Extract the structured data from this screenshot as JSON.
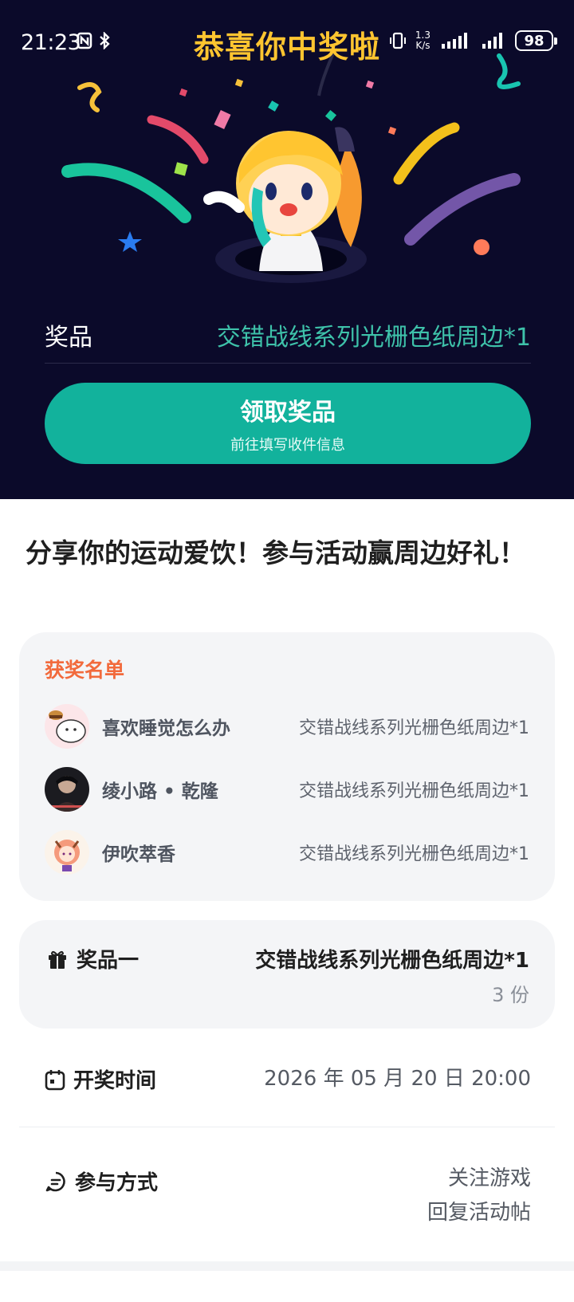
{
  "status_bar": {
    "time": "21:23",
    "speed_value": "1.3",
    "speed_unit": "K/s",
    "battery": "98"
  },
  "header": {
    "title": "恭喜你中奖啦"
  },
  "prize": {
    "label": "奖品",
    "value": "交错战线系列光栅色纸周边*1"
  },
  "claim": {
    "title": "领取奖品",
    "subtitle": "前往填写收件信息"
  },
  "event": {
    "title": "分享你的运动爱饮！参与活动赢周边好礼！"
  },
  "winners": {
    "heading": "获奖名单",
    "list": [
      {
        "name": "喜欢睡觉怎么办",
        "prize": "交错战线系列光栅色纸周边*1"
      },
      {
        "name": "绫小路 • 乾隆",
        "prize": "交错战线系列光栅色纸周边*1"
      },
      {
        "name": "伊吹萃香",
        "prize": "交错战线系列光栅色纸周边*1"
      }
    ]
  },
  "prize_item": {
    "label": "奖品一",
    "value": "交错战线系列光栅色纸周边*1",
    "quantity": "3 份",
    "icon": "gift-icon"
  },
  "draw_time": {
    "label": "开奖时间",
    "value": "2026 年 05 月 20 日 20:00",
    "icon": "calendar-icon"
  },
  "participation": {
    "label": "参与方式",
    "lines": [
      "关注游戏",
      "回复活动帖"
    ],
    "icon": "chat-icon"
  },
  "colors": {
    "hero_bg": "#0b0a2a",
    "accent": "#12b29c",
    "title_yellow": "#ffc530",
    "winner_heading": "#f26a3c"
  }
}
